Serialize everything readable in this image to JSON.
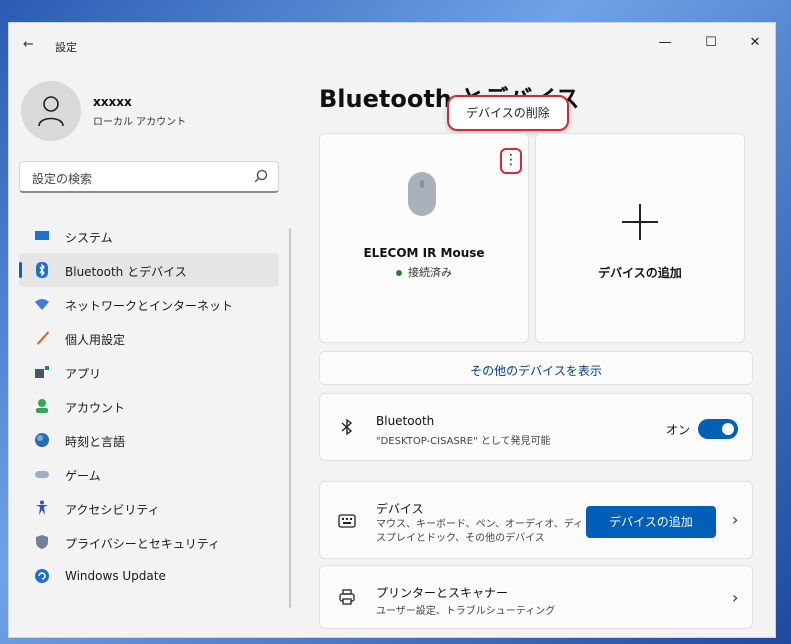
{
  "window": {
    "title": "設定",
    "back_icon": "back-arrow-icon",
    "min_label": "—",
    "max_label": "☐",
    "close_label": "✕"
  },
  "profile": {
    "name": "xxxxx",
    "account_type": "ローカル アカウント"
  },
  "search": {
    "placeholder": "設定の検索"
  },
  "sidebar": {
    "items": [
      {
        "label": "システム",
        "icon": "system-icon",
        "color": "#1f6fd1"
      },
      {
        "label": "Bluetooth とデバイス",
        "icon": "bluetooth-icon",
        "color": "#1f6fd1",
        "active": true
      },
      {
        "label": "ネットワークとインターネット",
        "icon": "wifi-icon",
        "color": "#3b7dd8"
      },
      {
        "label": "個人用設定",
        "icon": "brush-icon",
        "color": "#d46b1f"
      },
      {
        "label": "アプリ",
        "icon": "apps-icon",
        "color": "#4a5568"
      },
      {
        "label": "アカウント",
        "icon": "account-icon",
        "color": "#2fa84f"
      },
      {
        "label": "時刻と言語",
        "icon": "globe-icon",
        "color": "#2b6cb0"
      },
      {
        "label": "ゲーム",
        "icon": "gamepad-icon",
        "color": "#718096"
      },
      {
        "label": "アクセシビリティ",
        "icon": "accessibility-icon",
        "color": "#2b5ea7"
      },
      {
        "label": "プライバシーとセキュリティ",
        "icon": "shield-icon",
        "color": "#718096"
      },
      {
        "label": "Windows Update",
        "icon": "update-icon",
        "color": "#1f6fd1"
      }
    ]
  },
  "main": {
    "title": "Bluetooth とデバイス",
    "tooltip": "デバイスの削除",
    "device": {
      "name": "ELECOM IR Mouse",
      "status": "接続済み",
      "more_label": "⋮"
    },
    "add_device_label": "デバイスの追加",
    "show_more_label": "その他のデバイスを表示",
    "bluetooth": {
      "title": "Bluetooth",
      "subtitle": "\"DESKTOP-CISASRE\" として発見可能",
      "state": "オン"
    },
    "devices": {
      "title": "デバイス",
      "subtitle": "マウス、キーボード、ペン、オーディオ、ディスプレイとドック、その他のデバイス",
      "button": "デバイスの追加"
    },
    "printers": {
      "title": "プリンターとスキャナー",
      "subtitle": "ユーザー設定、トラブルシューティング"
    },
    "chevron": "›"
  },
  "colors": {
    "accent": "#005fb8",
    "highlight": "#d42a35"
  }
}
